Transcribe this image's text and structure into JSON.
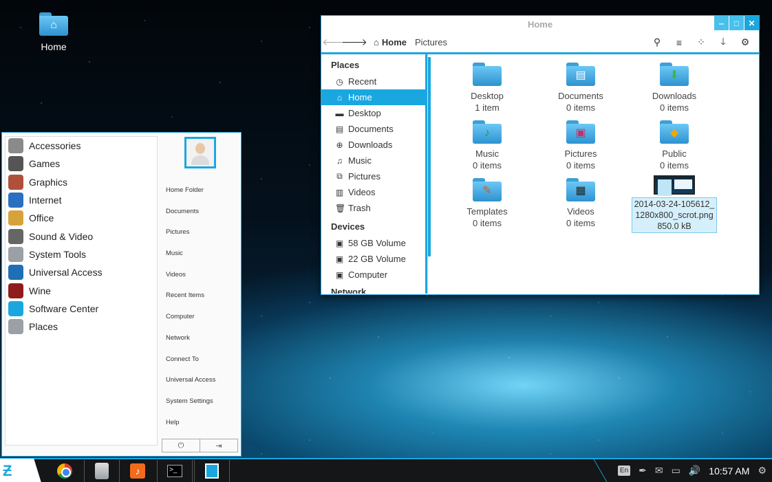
{
  "desktop": {
    "home_label": "Home"
  },
  "file_manager": {
    "title": "Home",
    "path": {
      "home": "Home",
      "pictures": "Pictures"
    },
    "sidebar": {
      "places_header": "Places",
      "places": [
        {
          "label": "Recent",
          "icon": "clock-icon"
        },
        {
          "label": "Home",
          "icon": "home-icon",
          "active": true
        },
        {
          "label": "Desktop",
          "icon": "desktop-icon"
        },
        {
          "label": "Documents",
          "icon": "document-icon"
        },
        {
          "label": "Downloads",
          "icon": "download-icon"
        },
        {
          "label": "Music",
          "icon": "music-icon"
        },
        {
          "label": "Pictures",
          "icon": "pictures-icon"
        },
        {
          "label": "Videos",
          "icon": "film-icon"
        },
        {
          "label": "Trash",
          "icon": "trash-icon"
        }
      ],
      "devices_header": "Devices",
      "devices": [
        {
          "label": "58 GB Volume",
          "icon": "drive-icon"
        },
        {
          "label": "22 GB Volume",
          "icon": "drive-icon"
        },
        {
          "label": "Computer",
          "icon": "computer-icon"
        }
      ],
      "network_header": "Network"
    },
    "items": [
      {
        "name": "Desktop",
        "count": "1 item",
        "icon": "desktop-folder-icon"
      },
      {
        "name": "Documents",
        "count": "0 items",
        "icon": "documents-folder-icon"
      },
      {
        "name": "Downloads",
        "count": "0 items",
        "icon": "downloads-folder-icon"
      },
      {
        "name": "Music",
        "count": "0 items",
        "icon": "music-folder-icon"
      },
      {
        "name": "Pictures",
        "count": "0 items",
        "icon": "pictures-folder-icon"
      },
      {
        "name": "Public",
        "count": "0 items",
        "icon": "public-folder-icon"
      },
      {
        "name": "Templates",
        "count": "0 items",
        "icon": "templates-folder-icon"
      },
      {
        "name": "Videos",
        "count": "0 items",
        "icon": "videos-folder-icon"
      }
    ],
    "selected_file": {
      "name_line1": "2014-03-24-105612_",
      "name_line2": "1280x800_scrot.png",
      "size": "850.0 kB"
    }
  },
  "start_menu": {
    "categories": [
      {
        "label": "Accessories",
        "icon": "accessories-icon",
        "color": "#8a8a8a"
      },
      {
        "label": "Games",
        "icon": "gamepad-icon",
        "color": "#555555"
      },
      {
        "label": "Graphics",
        "icon": "graphics-icon",
        "color": "#b0503a"
      },
      {
        "label": "Internet",
        "icon": "globe-icon",
        "color": "#2a6fc2"
      },
      {
        "label": "Office",
        "icon": "office-icon",
        "color": "#d8a23a"
      },
      {
        "label": "Sound & Video",
        "icon": "headphones-icon",
        "color": "#666666"
      },
      {
        "label": "System Tools",
        "icon": "tools-icon",
        "color": "#9aa0a6"
      },
      {
        "label": "Universal Access",
        "icon": "accessibility-icon",
        "color": "#1e6fb5"
      },
      {
        "label": "Wine",
        "icon": "wine-icon",
        "color": "#8e1c1c"
      },
      {
        "label": "Software Center",
        "icon": "software-center-icon",
        "color": "#1aa7e0"
      },
      {
        "label": "Places",
        "icon": "places-icon",
        "color": "#9aa0a6"
      }
    ],
    "links": [
      "Home Folder",
      "Documents",
      "Pictures",
      "Music",
      "Videos",
      "Recent Items",
      "Computer",
      "Network",
      "Connect To",
      "Universal Access",
      "System Settings",
      "Help"
    ]
  },
  "taskbar": {
    "apps": [
      "chrome-icon",
      "files-icon",
      "music-player-icon",
      "terminal-icon",
      "software-center-icon"
    ],
    "tray": {
      "language": "En",
      "clock": "10:57 AM"
    }
  },
  "colors": {
    "accent": "#1aa7e0"
  }
}
